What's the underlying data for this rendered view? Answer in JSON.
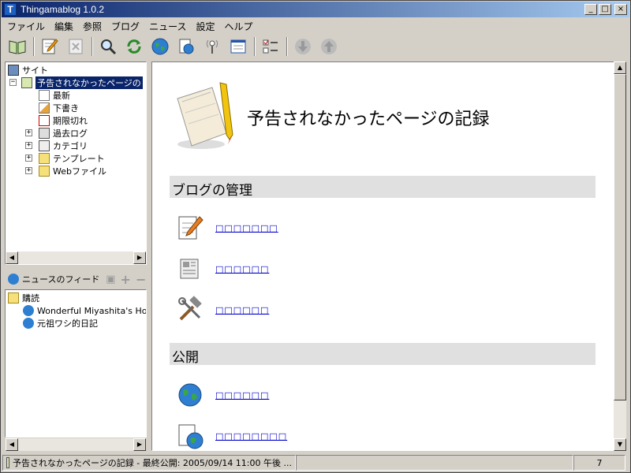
{
  "window": {
    "title": "Thingamablog 1.0.2",
    "controls": [
      "_",
      "□",
      "×"
    ]
  },
  "menu": [
    "ファイル",
    "編集",
    "参照",
    "ブログ",
    "ニュース",
    "設定",
    "ヘルプ"
  ],
  "toolbar": {
    "icons": [
      "open-book-icon",
      "edit-post-icon",
      "delete-post-icon",
      "search-icon",
      "refresh-icon",
      "globe-icon",
      "publish-icon",
      "feed-reader-icon",
      "properties-icon",
      "checklist-icon",
      "move-down-icon",
      "move-up-icon"
    ]
  },
  "tree": {
    "root": "サイト",
    "blog": "予告されなかったページの",
    "children": [
      "最新",
      "下書き",
      "期限切れ",
      "過去ログ",
      "カテゴリ",
      "テンプレート",
      "Webファイル"
    ]
  },
  "feeds": {
    "header": "ニュースのフィード",
    "folder": "購読",
    "items": [
      "Wonderful Miyashita's Hou",
      "元祖ワシ的日記"
    ]
  },
  "content": {
    "title": "予告されなかったページの記録",
    "sections": [
      {
        "heading": "ブログの管理",
        "links": [
          "□□□□□□□",
          "□□□□□□",
          "□□□□□□"
        ]
      },
      {
        "heading": "公開",
        "links": [
          "□□□□□□",
          "□□□□□□□□"
        ]
      }
    ]
  },
  "status": {
    "message": "予告されなかったページの記録 - 最終公開: 2005/09/14 11:00 午後 ...",
    "count": "7"
  },
  "colors": {
    "titlebar_start": "#0a246a",
    "titlebar_end": "#a6caf0",
    "selection": "#0a246a",
    "link": "#0000cc",
    "section_bg": "#e0e0e0"
  }
}
